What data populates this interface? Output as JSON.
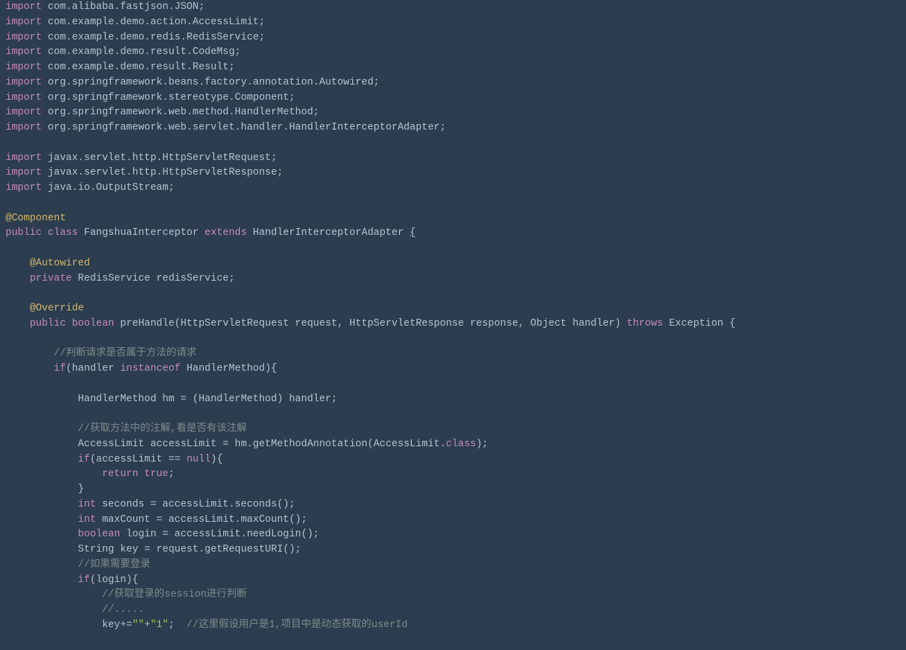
{
  "lines": [
    {
      "indent": 0,
      "html": "<span class='kw'>import</span> com.alibaba.fastjson.JSON;"
    },
    {
      "indent": 0,
      "html": "<span class='kw'>import</span> com.example.demo.action.AccessLimit;"
    },
    {
      "indent": 0,
      "html": "<span class='kw'>import</span> com.example.demo.redis.RedisService;"
    },
    {
      "indent": 0,
      "html": "<span class='kw'>import</span> com.example.demo.result.CodeMsg;"
    },
    {
      "indent": 0,
      "html": "<span class='kw'>import</span> com.example.demo.result.Result;"
    },
    {
      "indent": 0,
      "html": "<span class='kw'>import</span> org.springframework.beans.factory.annotation.Autowired;"
    },
    {
      "indent": 0,
      "html": "<span class='kw'>import</span> org.springframework.stereotype.Component;"
    },
    {
      "indent": 0,
      "html": "<span class='kw'>import</span> org.springframework.web.method.HandlerMethod;"
    },
    {
      "indent": 0,
      "html": "<span class='kw'>import</span> org.springframework.web.servlet.handler.HandlerInterceptorAdapter;"
    },
    {
      "indent": 0,
      "html": ""
    },
    {
      "indent": 0,
      "html": "<span class='kw'>import</span> javax.servlet.http.HttpServletRequest;"
    },
    {
      "indent": 0,
      "html": "<span class='kw'>import</span> javax.servlet.http.HttpServletResponse;"
    },
    {
      "indent": 0,
      "html": "<span class='kw'>import</span> java.io.OutputStream;"
    },
    {
      "indent": 0,
      "html": ""
    },
    {
      "indent": 0,
      "html": "<span class='ann'>@Component</span>"
    },
    {
      "indent": 0,
      "html": "<span class='kw'>public class</span> FangshuaInterceptor <span class='kw'>extends</span> HandlerInterceptorAdapter <span class='brace-hl'>{</span>"
    },
    {
      "indent": 0,
      "html": ""
    },
    {
      "indent": 1,
      "html": "<span class='ann'>@Autowired</span>"
    },
    {
      "indent": 1,
      "html": "<span class='kw'>private</span> RedisService redisService;"
    },
    {
      "indent": 0,
      "html": ""
    },
    {
      "indent": 1,
      "html": "<span class='ann'>@Override</span>"
    },
    {
      "indent": 1,
      "html": "<span class='kw'>public boolean</span> preHandle(HttpServletRequest request, HttpServletResponse response, Object handler) <span class='kw'>throws</span> Exception {"
    },
    {
      "indent": 0,
      "html": ""
    },
    {
      "indent": 2,
      "html": "<span class='comment'>//判断请求是否属于方法的请求</span>"
    },
    {
      "indent": 2,
      "html": "<span class='kw'>if</span>(handler <span class='kw'>instanceof</span> HandlerMethod){"
    },
    {
      "indent": 0,
      "html": ""
    },
    {
      "indent": 3,
      "html": "HandlerMethod hm = (HandlerMethod) handler;"
    },
    {
      "indent": 0,
      "html": ""
    },
    {
      "indent": 3,
      "html": "<span class='comment'>//获取方法中的注解,看是否有该注解</span>"
    },
    {
      "indent": 3,
      "html": "AccessLimit accessLimit = hm.getMethodAnnotation(AccessLimit.<span class='kw'>class</span>);"
    },
    {
      "indent": 3,
      "html": "<span class='kw'>if</span>(accessLimit == <span class='kw'>null</span>){"
    },
    {
      "indent": 4,
      "html": "<span class='kw'>return true</span>;"
    },
    {
      "indent": 3,
      "html": "}"
    },
    {
      "indent": 3,
      "html": "<span class='kw'>int</span> seconds = accessLimit.seconds();"
    },
    {
      "indent": 3,
      "html": "<span class='kw'>int</span> maxCount = accessLimit.maxCount();"
    },
    {
      "indent": 3,
      "html": "<span class='kw'>boolean</span> login = accessLimit.needLogin();"
    },
    {
      "indent": 3,
      "html": "String key = request.getRequestURI();"
    },
    {
      "indent": 3,
      "html": "<span class='comment'>//如果需要登录</span>"
    },
    {
      "indent": 3,
      "html": "<span class='kw'>if</span>(login){"
    },
    {
      "indent": 4,
      "html": "<span class='comment'>//获取登录的session进行判断</span>"
    },
    {
      "indent": 4,
      "html": "<span class='comment'>//.....</span>"
    },
    {
      "indent": 4,
      "html": "key+=<span class='str'>\"\"</span>+<span class='str'>\"1\"</span>;  <span class='comment'>//这里假设用户是1,项目中是动态获取的userId</span>"
    }
  ],
  "indent_unit": "    "
}
